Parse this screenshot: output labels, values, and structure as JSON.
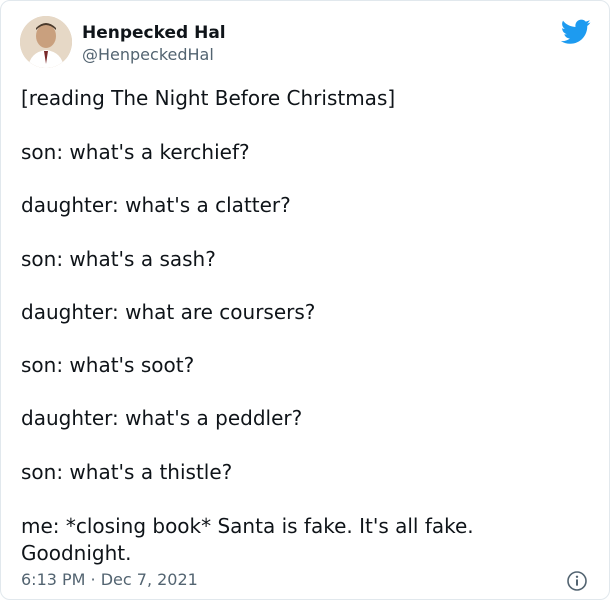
{
  "author": {
    "name": "Henpecked Hal",
    "handle": "@HenpeckedHal"
  },
  "tweet": {
    "lines": [
      "[reading The Night Before Christmas]",
      "son: what's a kerchief?",
      "daughter: what's a clatter?",
      "son: what's a sash?",
      "daughter: what are coursers?",
      "son: what's soot?",
      "daughter: what's a peddler?",
      "son: what's a thistle?",
      "me: *closing book* Santa is fake. It's all fake. Goodnight."
    ]
  },
  "meta": {
    "timestamp": "6:13 PM · Dec 7, 2021"
  },
  "icons": {
    "logo": "twitter-bird-icon",
    "info": "info-icon"
  },
  "colors": {
    "brand": "#1d9bf0",
    "secondary_text": "#536471",
    "text": "#0f1419"
  }
}
